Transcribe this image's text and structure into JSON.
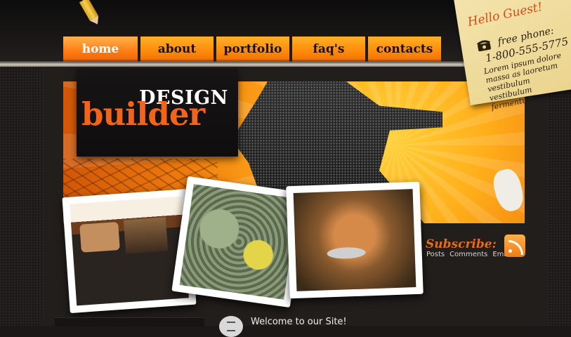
{
  "nav": {
    "items": [
      {
        "label": "home",
        "active": true
      },
      {
        "label": "about",
        "active": false
      },
      {
        "label": "portfolio",
        "active": false
      },
      {
        "label": "faq's",
        "active": false
      },
      {
        "label": "contacts",
        "active": false
      }
    ]
  },
  "logo": {
    "line1": "DESIGN",
    "line2": "builder"
  },
  "note": {
    "greeting": "Hello Guest!",
    "free_phone_label": "free phone:",
    "phone": "1-800-555-5775",
    "body": "Lorem ipsum dolore massa as laoretum vestibulum vestibulum fermentum"
  },
  "subscribe": {
    "title": "Subscribe:",
    "links": [
      "Posts",
      "Comments",
      "Email"
    ]
  },
  "welcome": {
    "text": "Welcome to our Site!"
  },
  "icons": {
    "phone": "telephone-icon",
    "rss": "rss-feed-icon",
    "document": "document-icon"
  },
  "colors": {
    "accent": "#f1641a",
    "nav_orange": "#ff8d0c",
    "background": "#1b1817"
  }
}
